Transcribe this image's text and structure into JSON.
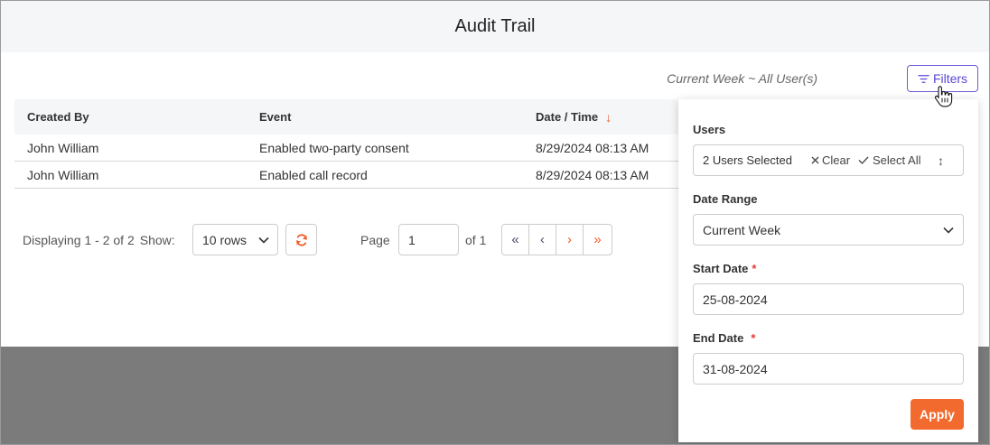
{
  "page": {
    "title": "Audit Trail"
  },
  "toolbar": {
    "filter_summary": "Current Week  ~ All User(s)",
    "filters_label": "Filters"
  },
  "table": {
    "columns": [
      "Created By",
      "Event",
      "Date / Time"
    ],
    "sort_column": "Date / Time",
    "sort_direction": "descending",
    "rows": [
      {
        "created_by": "John William",
        "event": "Enabled two-party consent",
        "datetime": "8/29/2024 08:13 AM"
      },
      {
        "created_by": "John William",
        "event": "Enabled call record",
        "datetime": "8/29/2024 08:13 AM"
      }
    ]
  },
  "pagination": {
    "displaying": "Displaying 1 - 2 of 2",
    "show_label": "Show:",
    "rows_option": "10 rows",
    "page_label": "Page",
    "page_value": "1",
    "of_label": "of 1"
  },
  "filter_panel": {
    "users_label": "Users",
    "users_value": "2 Users Selected",
    "clear_label": "Clear",
    "select_all_label": "Select All",
    "date_range_label": "Date Range",
    "date_range_value": "Current Week",
    "start_date_label": "Start Date",
    "start_date_value": "25-08-2024",
    "end_date_label": "End Date",
    "end_date_value": "31-08-2024",
    "required_mark": "*",
    "apply_label": "Apply"
  },
  "colors": {
    "accent_purple": "#5a48d6",
    "accent_orange": "#f26a2e",
    "required_red": "#e53935"
  },
  "icons": [
    "filter-icon",
    "sort-down-icon",
    "chevron-down-icon",
    "refresh-icon",
    "first-page-icon",
    "prev-page-icon",
    "next-page-icon",
    "last-page-icon",
    "close-icon",
    "check-icon",
    "updown-icon",
    "hand-cursor-icon"
  ]
}
